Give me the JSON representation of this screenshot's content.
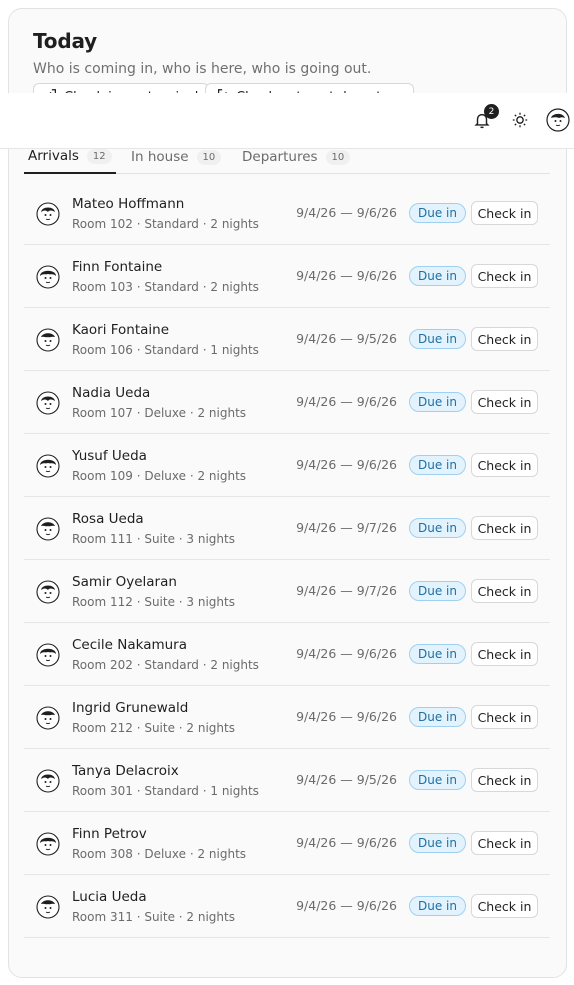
{
  "header": {
    "title": "Today",
    "subtitle": "Who is coming in, who is here, who is going out.",
    "check_in_next_label": "Check in next arrival",
    "check_out_next_label": "Check out next departure"
  },
  "topbar": {
    "notifications_count": "2",
    "icons": [
      "bell-icon",
      "sun-icon",
      "user-avatar"
    ]
  },
  "tabs": [
    {
      "label": "Arrivals",
      "count": "12",
      "active": true
    },
    {
      "label": "In house",
      "count": "10",
      "active": false
    },
    {
      "label": "Departures",
      "count": "10",
      "active": false
    }
  ],
  "colors": {
    "status_bg": "#e3f3fd",
    "status_border": "#9fd0ef",
    "status_text": "#1d6fa3"
  },
  "arrivals": [
    {
      "name": "Mateo Hoffmann",
      "meta": "Room 102 · Standard · 2 nights",
      "dates": "9/4/26 — 9/6/26",
      "status": "Due in",
      "action": "Check in"
    },
    {
      "name": "Finn Fontaine",
      "meta": "Room 103 · Standard · 2 nights",
      "dates": "9/4/26 — 9/6/26",
      "status": "Due in",
      "action": "Check in"
    },
    {
      "name": "Kaori Fontaine",
      "meta": "Room 106 · Standard · 1 nights",
      "dates": "9/4/26 — 9/5/26",
      "status": "Due in",
      "action": "Check in"
    },
    {
      "name": "Nadia Ueda",
      "meta": "Room 107 · Deluxe · 2 nights",
      "dates": "9/4/26 — 9/6/26",
      "status": "Due in",
      "action": "Check in"
    },
    {
      "name": "Yusuf Ueda",
      "meta": "Room 109 · Deluxe · 2 nights",
      "dates": "9/4/26 — 9/6/26",
      "status": "Due in",
      "action": "Check in"
    },
    {
      "name": "Rosa Ueda",
      "meta": "Room 111 · Suite · 3 nights",
      "dates": "9/4/26 — 9/7/26",
      "status": "Due in",
      "action": "Check in"
    },
    {
      "name": "Samir Oyelaran",
      "meta": "Room 112 · Suite · 3 nights",
      "dates": "9/4/26 — 9/7/26",
      "status": "Due in",
      "action": "Check in"
    },
    {
      "name": "Cecile Nakamura",
      "meta": "Room 202 · Standard · 2 nights",
      "dates": "9/4/26 — 9/6/26",
      "status": "Due in",
      "action": "Check in"
    },
    {
      "name": "Ingrid Grunewald",
      "meta": "Room 212 · Suite · 2 nights",
      "dates": "9/4/26 — 9/6/26",
      "status": "Due in",
      "action": "Check in"
    },
    {
      "name": "Tanya Delacroix",
      "meta": "Room 301 · Standard · 1 nights",
      "dates": "9/4/26 — 9/5/26",
      "status": "Due in",
      "action": "Check in"
    },
    {
      "name": "Finn Petrov",
      "meta": "Room 308 · Deluxe · 2 nights",
      "dates": "9/4/26 — 9/6/26",
      "status": "Due in",
      "action": "Check in"
    },
    {
      "name": "Lucia Ueda",
      "meta": "Room 311 · Suite · 2 nights",
      "dates": "9/4/26 — 9/6/26",
      "status": "Due in",
      "action": "Check in"
    }
  ]
}
